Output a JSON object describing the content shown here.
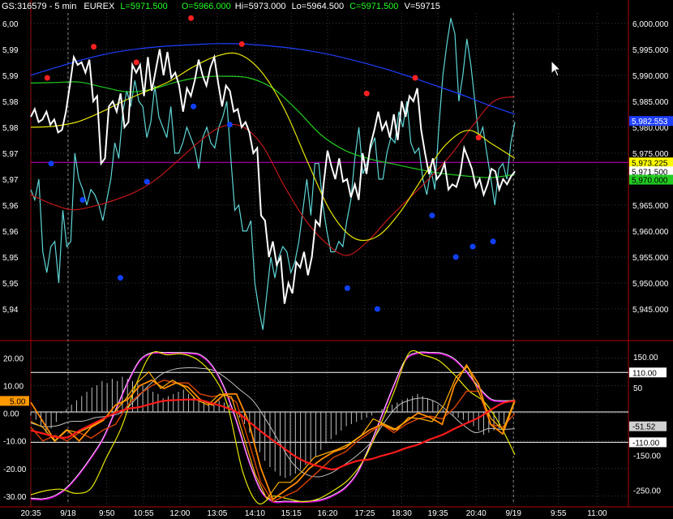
{
  "header": {
    "symbol": "GS:316579 - 5 min",
    "exchange": "EUREX",
    "last": "L=5971.500",
    "open": "O=5966.000",
    "high": "Hi=5973.000",
    "low": "Lo=5964.500",
    "close": "C=5971.500",
    "volume": "V=59715"
  },
  "colors": {
    "price": "#ffffff",
    "cyan": "#5fd6d6",
    "blue_ma": "#1f3fff",
    "green_ma": "#22cc22",
    "yellow_ma": "#e6e600",
    "red_ma": "#c01818",
    "magenta_line": "#d000d0",
    "dot_red": "#ff2020",
    "dot_blue": "#1040ff",
    "grid": "#3a3a3a",
    "border": "#b00000"
  },
  "chart_data": [
    {
      "type": "line",
      "title": "",
      "ylim": [
        5940,
        6002
      ],
      "left_tick_labels": [
        "6,00",
        "5,99",
        "5,99",
        "5,98",
        "5,98",
        "5,97",
        "5,97",
        "5,96",
        "5,96",
        "5,95",
        "5,95",
        "5,94"
      ],
      "left_tick_values": [
        6000,
        5995,
        5990,
        5985,
        5980,
        5975,
        5970,
        5965,
        5960,
        5955,
        5950,
        5945
      ],
      "right_tick_labels": [
        "6,000.000",
        "5,995.000",
        "5,990.000",
        "5,985.000",
        "5,980.000",
        "5,975.000",
        "5,970.000",
        "5,965.000",
        "5,960.000",
        "5,955.000",
        "5,950.000",
        "5,945.000"
      ],
      "right_tick_values": [
        6000,
        5995,
        5990,
        5985,
        5980,
        5975,
        5970,
        5965,
        5960,
        5955,
        5950,
        5945
      ],
      "x_tick_labels": [
        "20:35",
        "9/18",
        "9:50",
        "10:55",
        "12:00",
        "13:05",
        "14:10",
        "15:15",
        "16:20",
        "17:25",
        "18:30",
        "19:35",
        "20:40",
        "9/19",
        "9:55",
        "11:00"
      ],
      "x_tick_positions": [
        0,
        0.077,
        0.157,
        0.233,
        0.308,
        0.385,
        0.463,
        0.538,
        0.613,
        0.69,
        0.766,
        0.841,
        0.92,
        0.997,
        1.09,
        1.17
      ],
      "session_breaks": [
        0.077,
        0.997
      ],
      "value_labels": [
        {
          "text": "5,982.553",
          "value": 5981.2,
          "bg": "#1f3fff",
          "fg": "#ffffff"
        },
        {
          "text": "5,973.225",
          "value": 5973.225,
          "bg": "#ffff00",
          "fg": "#000000"
        },
        {
          "text": "5,971.500",
          "value": 5971.5,
          "bg": "#ffffff",
          "fg": "#000000"
        },
        {
          "text": "5,970.000",
          "value": 5969.9,
          "bg": "#22cc22",
          "fg": "#000000"
        }
      ],
      "horizontal_line": {
        "value": 5973.225,
        "color": "#d000d0"
      },
      "series": [
        {
          "key": "price",
          "values": [
            5982,
            5983.5,
            5981,
            5981.5,
            5983,
            5980.5,
            5981.5,
            5979,
            5979.5,
            5983,
            5988,
            5993.5,
            5992,
            5992.5,
            5990.5,
            5993,
            5985,
            5986,
            5973,
            5974,
            5984,
            5985,
            5983,
            5986.5,
            5980,
            5981,
            5992,
            5990.5,
            5992,
            5986,
            5993.5,
            5987,
            5991,
            5995,
            5990,
            5994.5,
            5989.5,
            5990.5,
            5988,
            5983,
            5987.5,
            5986,
            5989,
            5993,
            5990,
            5988,
            5991.5,
            5993.5,
            5988.5,
            5984,
            5988,
            5987,
            5983,
            5983.5,
            5980,
            5981,
            5979,
            5975,
            5976,
            5963,
            5962,
            5955,
            5958,
            5953.5,
            5955,
            5946,
            5950,
            5948,
            5954,
            5953,
            5956,
            5951.5,
            5955,
            5962,
            5961,
            5969,
            5975.5,
            5972.5,
            5970,
            5974,
            5969.5,
            5970,
            5966.5,
            5969,
            5966,
            5975,
            5971,
            5976.5,
            5979.5,
            5983,
            5979.5,
            5981,
            5978,
            5982.5,
            5977.5,
            5985,
            5982,
            5986,
            5985,
            5987.5,
            5979.5,
            5975,
            5971,
            5974,
            5970,
            5971,
            5973,
            5968,
            5969,
            5968.5,
            5971,
            5976,
            5974,
            5972,
            5968.5,
            5970,
            5967,
            5969,
            5972,
            5971.5,
            5968,
            5970,
            5969,
            5970.5,
            5971.5
          ]
        },
        {
          "key": "cyan",
          "values": [
            5968,
            5966,
            5970,
            5956,
            5952,
            5957,
            5958,
            5950,
            5964,
            5957,
            5958,
            5975,
            5970,
            5968,
            5965,
            5968,
            5967,
            5965,
            5962,
            5966,
            5970,
            5977,
            5974,
            5983,
            5987,
            5984,
            5989,
            5985,
            5984,
            5978,
            5981,
            5988,
            5982,
            5980,
            5978,
            5984,
            5975,
            5975,
            5977,
            5980,
            5978,
            5976,
            5972,
            5978,
            5980,
            5977,
            5976,
            5980,
            5982,
            5985,
            5974,
            5964,
            5965,
            5960,
            5960,
            5962,
            5950,
            5945,
            5941,
            5948,
            5955,
            5951,
            5955,
            5957,
            5956,
            5952,
            5954,
            5958,
            5964,
            5970,
            5963,
            5973,
            5973,
            5965,
            5960,
            5956,
            5956,
            5958,
            5957,
            5962,
            5966,
            5974,
            5980,
            5971,
            5973,
            5976,
            5978,
            5970,
            5970,
            5975,
            5978,
            5977,
            5983,
            5980,
            5985,
            5977,
            5975,
            5976,
            5970,
            5967,
            5972,
            5968,
            5980,
            5990,
            5996,
            6001,
            5998,
            5985,
            5990,
            5997,
            5992,
            5985,
            5978,
            5980,
            5975,
            5970,
            5965,
            5972,
            5973,
            5970,
            5977,
            5981
          ]
        },
        {
          "key": "blue_ma",
          "values": [
            5990.0,
            5991.6,
            5993.1,
            5994.3,
            5995.1,
            5995.6,
            5995.9,
            5996.1,
            5996.0,
            5995.6,
            5995.0,
            5994.1,
            5992.9,
            5991.5,
            5989.9,
            5988.1,
            5986.3,
            5984.3,
            5982.5
          ]
        },
        {
          "key": "green_ma",
          "values": [
            5988.5,
            5988.6,
            5988.7,
            5987.7,
            5986.8,
            5987.3,
            5988.7,
            5989.6,
            5989.8,
            5989.5,
            5987.5,
            5983.3,
            5978.5,
            5975.5,
            5973.9,
            5972.9,
            5971.9,
            5971.1,
            5970.6,
            5970.3,
            5970.9
          ]
        },
        {
          "key": "yellow_ma",
          "values": [
            5980.0,
            5980.2,
            5981.0,
            5982.8,
            5985.0,
            5986.9,
            5988.8,
            5991.5,
            5993.6,
            5994.1,
            5990.7,
            5983.5,
            5973.4,
            5963.8,
            5958.7,
            5958.9,
            5963.5,
            5970.3,
            5976.6,
            5979.4,
            5976.8,
            5974.0
          ]
        },
        {
          "key": "red_ma",
          "values": [
            5967.0,
            5965.2,
            5964.1,
            5964.8,
            5966.0,
            5967.6,
            5970.1,
            5973.6,
            5977.2,
            5980.0,
            5980.2,
            5976.5,
            5969.0,
            5962.4,
            5957.8,
            5955.3,
            5958.0,
            5962.4,
            5966.4,
            5970.4,
            5974.9,
            5980.3,
            5985.0,
            5985.9
          ]
        }
      ],
      "red_dots": [
        [
          0.034,
          5989.5
        ],
        [
          0.13,
          5995.5
        ],
        [
          0.218,
          5992.5
        ],
        [
          0.331,
          6001
        ],
        [
          0.436,
          5996
        ],
        [
          0.694,
          5986.5
        ],
        [
          0.794,
          5989.5
        ],
        [
          0.925,
          5978
        ]
      ],
      "blue_dots": [
        [
          0.042,
          5973
        ],
        [
          0.107,
          5966
        ],
        [
          0.185,
          5951
        ],
        [
          0.24,
          5969.5
        ],
        [
          0.336,
          5984
        ],
        [
          0.411,
          5980.5
        ],
        [
          0.654,
          5949
        ],
        [
          0.716,
          5945
        ],
        [
          0.829,
          5963
        ],
        [
          0.878,
          5955
        ],
        [
          0.913,
          5957
        ],
        [
          0.955,
          5958
        ]
      ]
    },
    {
      "type": "line",
      "title": "",
      "ylim": [
        -33,
        24
      ],
      "left_tick_labels": [
        "20.00",
        "10.00",
        "0.00",
        "-10.00",
        "-20.00",
        "-30.00"
      ],
      "left_tick_values": [
        20,
        10,
        0,
        -10,
        -20,
        -30
      ],
      "right_tick_labels": [
        "150.00",
        "50",
        "-150.00",
        "-250.00"
      ],
      "right_tick_values": [
        20.5,
        9.3,
        -15.2,
        -27.8
      ],
      "reference_lines": [
        {
          "value": 14.8,
          "label": "110.00"
        },
        {
          "value": 0.5
        },
        {
          "value": -10.5,
          "label": "-110.00"
        }
      ],
      "value_labels": [
        {
          "text": "5.00",
          "value": 4.5,
          "side": "left",
          "bg": "#ff9900",
          "fg": "#000000"
        },
        {
          "text": "110.00",
          "value": 14.8,
          "side": "right",
          "bg": "#ffffff",
          "fg": "#000000"
        },
        {
          "text": "-51.52",
          "value": -4.7,
          "side": "right",
          "bg": "#d0d0d0",
          "fg": "#000000"
        },
        {
          "text": "-110.00",
          "value": -10.5,
          "side": "right",
          "bg": "#ffffff",
          "fg": "#000000"
        }
      ],
      "series": [
        {
          "key": "magenta",
          "values": [
            -31,
            -31.2,
            -30,
            -27,
            -22,
            -16,
            -9,
            1,
            11,
            19,
            21.7,
            21.8,
            21.8,
            21.7,
            21,
            17,
            9,
            -3,
            -17,
            -28,
            -32,
            -32.1,
            -32.2,
            -32.1,
            -31.5,
            -29.8,
            -27,
            -21.5,
            -12,
            -1,
            10,
            19.5,
            21.8,
            21.8,
            21.5,
            19.5,
            15,
            9.3,
            5,
            4.3,
            4.5
          ]
        },
        {
          "key": "yellow",
          "values": [
            -29.5,
            -28,
            -27.5,
            -29,
            -27,
            -16,
            -5,
            11,
            21.7,
            21.2,
            21.5,
            19.5,
            14,
            3,
            -21,
            -32.5,
            -30,
            -31,
            -32,
            -31,
            -28,
            -24,
            -17,
            -5.5,
            7.6,
            21.8,
            21,
            19,
            14,
            8,
            4,
            -4,
            -15
          ]
        },
        {
          "key": "white",
          "values": [
            -3.5,
            -4.8,
            -4.5,
            -3,
            -2.8,
            -1.5,
            -1,
            0.5,
            5,
            10,
            14.2,
            16,
            16.5,
            16.3,
            15.5,
            12.5,
            8.5,
            4.5,
            -2.5,
            -10.5,
            -18,
            -22,
            -23,
            -21.5,
            -18.5,
            -15,
            -10.5,
            -3.5,
            2.5,
            4.8,
            5.5,
            4,
            0.2,
            -4,
            -7,
            -5.5,
            -5.8,
            -5.6
          ]
        },
        {
          "key": "orange",
          "values": [
            4,
            -3,
            -10,
            -6,
            -10,
            -5,
            -2.5,
            3,
            5,
            10,
            12,
            9,
            11,
            9.5,
            5,
            3,
            7,
            7,
            -3,
            -19.8,
            -31.2,
            -28,
            -25,
            -20,
            -16.7,
            -14,
            -12.5,
            -9,
            -6,
            -4,
            -6,
            -3,
            0.1,
            -1.5,
            -4,
            10,
            17.5,
            10.6,
            -4,
            -7.5,
            4.5
          ]
        },
        {
          "key": "bright_orange",
          "values": [
            -3,
            -5,
            -10,
            -6,
            -7,
            -5,
            -2.5,
            0,
            5,
            11,
            15,
            9,
            12,
            9.5,
            5,
            3,
            7,
            6,
            -8,
            -22,
            -31,
            -25,
            -25,
            -21,
            -16,
            -14.5,
            -13,
            -11,
            -8,
            -2,
            -4,
            -6,
            -1.5,
            -2,
            -3,
            3,
            13,
            17,
            7,
            -2,
            -6,
            5
          ]
        },
        {
          "key": "dark_orange",
          "values": [
            -5,
            -10,
            -8,
            -10,
            -7,
            -9,
            -6,
            -4,
            3,
            7,
            10,
            12,
            11,
            11,
            7,
            6,
            7,
            4,
            -10,
            -25,
            -32,
            -30,
            -28,
            -24,
            -20,
            -16,
            -14,
            -10,
            -7,
            -4,
            -7,
            -4,
            -2,
            -1,
            -2,
            2,
            8,
            8,
            -4,
            -5,
            0
          ]
        },
        {
          "key": "red",
          "values": [
            -6.2,
            -7.3,
            -8.5,
            -8.7,
            -6.3,
            -4.1,
            -1.9,
            0.2,
            1.6,
            2.3,
            3.5,
            4.5,
            4.8,
            5.0,
            4.8,
            3.6,
            2.3,
            0.5,
            -2.9,
            -6.5,
            -9.8,
            -12.9,
            -16.0,
            -18.1,
            -19.4,
            -20.3,
            -18.7,
            -17.2,
            -16.7,
            -15.4,
            -14.2,
            -12.6,
            -11.3,
            -9.4,
            -7.8,
            -5.6,
            -3.6,
            -1.6,
            1.2,
            3.7,
            4.5
          ]
        },
        {
          "key": "histogram",
          "values": [
            -1,
            -3,
            -6,
            -9,
            -7,
            -4,
            0,
            2,
            4,
            6,
            8,
            10,
            12,
            13,
            15,
            14,
            16,
            15,
            17,
            16,
            15,
            14,
            13,
            12,
            10,
            9,
            7,
            8,
            9,
            10,
            11,
            9,
            8,
            7,
            6,
            5,
            4,
            6,
            5,
            4,
            1,
            -2,
            -5,
            -9,
            -14,
            -18,
            -22,
            -25,
            -27,
            -29,
            -30,
            -29,
            -28,
            -26,
            -24,
            -22,
            -20,
            -17,
            -14,
            -12,
            -10,
            -8,
            -6,
            -5,
            -4,
            -3,
            -2,
            -1,
            1,
            2,
            3,
            4,
            5,
            6,
            7,
            8,
            9,
            8,
            7,
            6,
            4,
            2,
            0,
            -1,
            -2,
            -3,
            -4,
            -6,
            -8,
            -10,
            -9,
            -8,
            -7,
            -5,
            -3
          ]
        }
      ]
    }
  ]
}
